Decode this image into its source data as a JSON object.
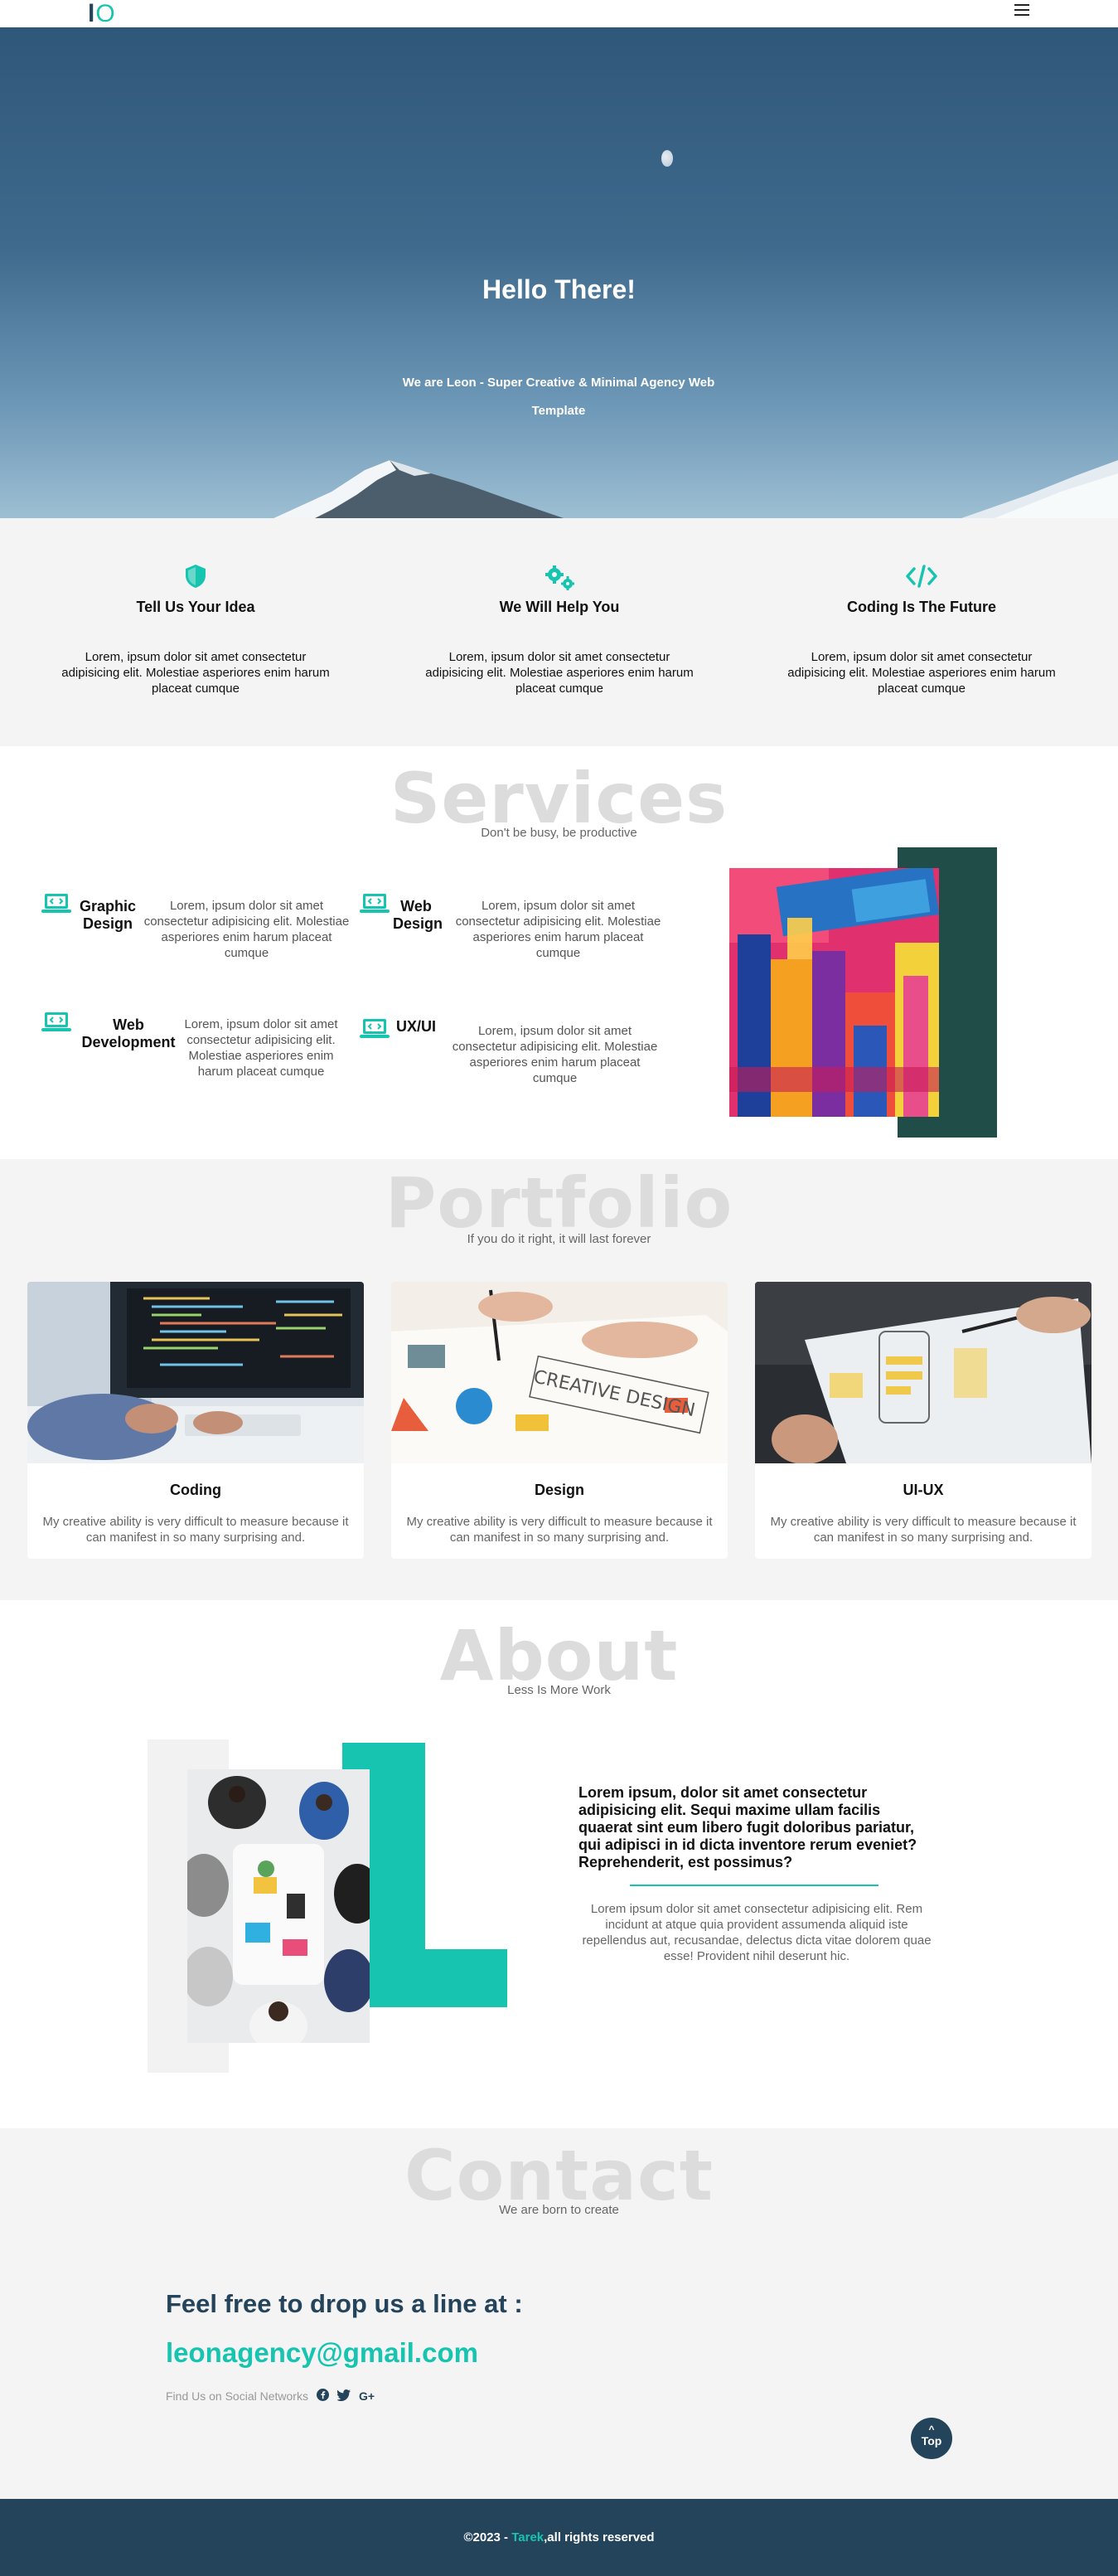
{
  "header": {
    "logo_l": "l",
    "logo_o": "O",
    "menu_icon": "hamburger-icon"
  },
  "hero": {
    "title": "Hello There!",
    "subtitle": "We are Leon - Super Creative & Minimal Agency Web Template"
  },
  "features": [
    {
      "icon": "shield-icon",
      "title": "Tell Us Your Idea",
      "text": "Lorem, ipsum dolor sit amet consectetur adipisicing elit. Molestiae asperiores enim harum placeat cumque"
    },
    {
      "icon": "gears-icon",
      "title": "We Will Help You",
      "text": "Lorem, ipsum dolor sit amet consectetur adipisicing elit. Molestiae asperiores enim harum placeat cumque"
    },
    {
      "icon": "code-icon",
      "title": "Coding Is The Future",
      "text": "Lorem, ipsum dolor sit amet consectetur adipisicing elit. Molestiae asperiores enim harum placeat cumque"
    }
  ],
  "services": {
    "title": "Services",
    "subtitle": "Don't be busy, be productive",
    "items": [
      {
        "icon": "laptop-code-icon",
        "name": "Graphic Design",
        "text": "Lorem, ipsum dolor sit amet consectetur adipisicing elit. Molestiae asperiores enim harum placeat cumque"
      },
      {
        "icon": "laptop-code-icon",
        "name": "Web Design",
        "text": "Lorem, ipsum dolor sit amet consectetur adipisicing elit. Molestiae asperiores enim harum placeat cumque"
      },
      {
        "icon": "laptop-code-icon",
        "name": "Web Development",
        "text": "Lorem, ipsum dolor sit amet consectetur adipisicing elit. Molestiae asperiores enim harum placeat cumque"
      },
      {
        "icon": "laptop-code-icon",
        "name": "UX/UI",
        "text": "Lorem, ipsum dolor sit amet consectetur adipisicing elit. Molestiae asperiores enim harum placeat cumque"
      }
    ]
  },
  "portfolio": {
    "title": "Portfolio",
    "subtitle": "If you do it right, it will last forever",
    "cards": [
      {
        "title": "Coding",
        "text": "My creative ability is very difficult to measure because it can manifest in so many surprising and."
      },
      {
        "title": "Design",
        "text": "My creative ability is very difficult to measure because it can manifest in so many surprising and."
      },
      {
        "title": "UI-UX",
        "text": "My creative ability is very difficult to measure because it can manifest in so many surprising and."
      }
    ]
  },
  "about": {
    "title": "About",
    "subtitle": "Less Is More Work",
    "heading": "Lorem ipsum, dolor sit amet consectetur adipisicing elit. Sequi maxime ullam facilis quaerat sint eum libero fugit doloribus pariatur, qui adipisci in id dicta inventore rerum eveniet? Reprehenderit, est possimus?",
    "text": "Lorem ipsum dolor sit amet consectetur adipisicing elit. Rem incidunt at atque quia provident assumenda aliquid iste repellendus aut, recusandae, delectus dicta vitae dolorem quae esse! Provident nihil deserunt hic."
  },
  "contact": {
    "title": "Contact",
    "subtitle": "We are born to create",
    "heading": "Feel free to drop us a line at :",
    "email": "leonagency@gmail.com",
    "social_label": "Find Us on Social Networks",
    "social_icons": [
      "facebook-icon",
      "twitter-icon",
      "google-plus-icon"
    ],
    "top_button": "Top"
  },
  "footer": {
    "prefix": "©2023 - ",
    "name": "Tarek",
    "suffix": ",all rights reserved"
  },
  "colors": {
    "accent": "#17c4b0",
    "navy": "#24445c",
    "dark_teal": "#204d48"
  }
}
